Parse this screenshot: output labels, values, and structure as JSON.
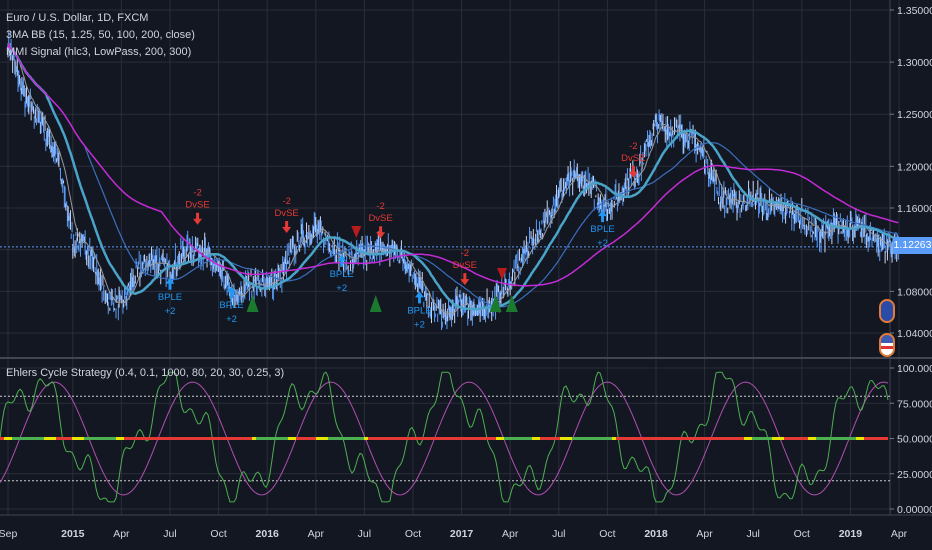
{
  "legend": {
    "symbol": "Euro / U.S. Dollar, 1D, FXCM",
    "indicator1": "3MA BB (15, 1.25, 50, 100, 200, close)",
    "indicator2": "MMI Signal (hlc3, LowPass, 200, 300)",
    "oscillator": "Ehlers Cycle Strategy (0.4, 0.1, 1000, 80, 20, 30, 0.25, 3)"
  },
  "colors": {
    "bg": "#131722",
    "grid": "#2a2e39",
    "bars": "#5b9cf6",
    "sma200": "#c42bd6",
    "ma50": "#4aa3c8",
    "ma100": "#3a6fbf",
    "ma15": "#9a9a9a",
    "osc_fast": "#4caf50",
    "osc_slow": "#b04fb0",
    "signal_short": "#e53935",
    "signal_long": "#2196f3",
    "triangle": "#1b7a2e",
    "last_price": "#5b9cf6"
  },
  "current_price": "1.12263",
  "chart_data": [
    {
      "type": "line",
      "title": "Euro / U.S. Dollar, 1D, FXCM",
      "y_ticks": [
        "1.35000",
        "1.30000",
        "1.25000",
        "1.20000",
        "1.16000",
        "1.08000",
        "1.04000"
      ],
      "ylim": [
        1.04,
        1.35
      ],
      "x_ticks": [
        "Sep",
        "2015",
        "Apr",
        "Jul",
        "Oct",
        "2016",
        "Apr",
        "Jul",
        "Oct",
        "2017",
        "Apr",
        "Jul",
        "Oct",
        "2018",
        "Apr",
        "Jul",
        "Oct",
        "2019",
        "Apr"
      ],
      "x_tick_month_index": [
        0,
        4,
        7,
        10,
        13,
        16,
        19,
        22,
        25,
        28,
        31,
        34,
        37,
        40,
        43,
        46,
        49,
        52,
        55
      ],
      "monthly_close": [
        1.32,
        1.265,
        1.245,
        1.21,
        1.13,
        1.12,
        1.075,
        1.065,
        1.1,
        1.11,
        1.1,
        1.12,
        1.12,
        1.1,
        1.07,
        1.09,
        1.085,
        1.1,
        1.13,
        1.14,
        1.125,
        1.11,
        1.115,
        1.12,
        1.12,
        1.1,
        1.065,
        1.055,
        1.07,
        1.06,
        1.07,
        1.09,
        1.12,
        1.14,
        1.175,
        1.19,
        1.18,
        1.16,
        1.18,
        1.2,
        1.24,
        1.235,
        1.23,
        1.21,
        1.17,
        1.165,
        1.17,
        1.16,
        1.16,
        1.15,
        1.135,
        1.14,
        1.145,
        1.135,
        1.125,
        1.123
      ],
      "signals": [
        {
          "label": "DvSE",
          "qty": "-2",
          "side": "short",
          "month": 11.7,
          "price": 1.143
        },
        {
          "label": "DvSE",
          "qty": "-2",
          "side": "short",
          "month": 17.2,
          "price": 1.135
        },
        {
          "label": "DvSE",
          "qty": "-2",
          "side": "short",
          "month": 23.0,
          "price": 1.13
        },
        {
          "label": "DvSE",
          "qty": "-2",
          "side": "short",
          "month": 28.2,
          "price": 1.085
        },
        {
          "label": "DvSE",
          "qty": "-2",
          "side": "short",
          "month": 38.6,
          "price": 1.188
        },
        {
          "label": "BPLE",
          "qty": "+2",
          "side": "long",
          "month": 10.0,
          "price": 1.093
        },
        {
          "label": "BPLE",
          "qty": "+2",
          "side": "long",
          "month": 13.8,
          "price": 1.085
        },
        {
          "label": "BPLE",
          "qty": "+2",
          "side": "long",
          "month": 20.6,
          "price": 1.115
        },
        {
          "label": "BPLE",
          "qty": "+2",
          "side": "long",
          "month": 25.4,
          "price": 1.08
        },
        {
          "label": "BPLE",
          "qty": "+2",
          "side": "long",
          "month": 36.7,
          "price": 1.158
        }
      ],
      "green_triangles_month": [
        15.1,
        22.7,
        30.1,
        31.1
      ],
      "red_triangles_month": [
        21.5,
        30.5
      ]
    },
    {
      "type": "line",
      "title": "Ehlers Cycle Strategy (0.4, 0.1, 1000, 80, 20, 30, 0.25, 3)",
      "y_ticks": [
        "100.00000",
        "75.00000",
        "50.00000",
        "25.00000",
        "0.00000"
      ],
      "ylim": [
        0,
        100
      ],
      "levels": [
        80,
        50,
        20
      ]
    }
  ]
}
